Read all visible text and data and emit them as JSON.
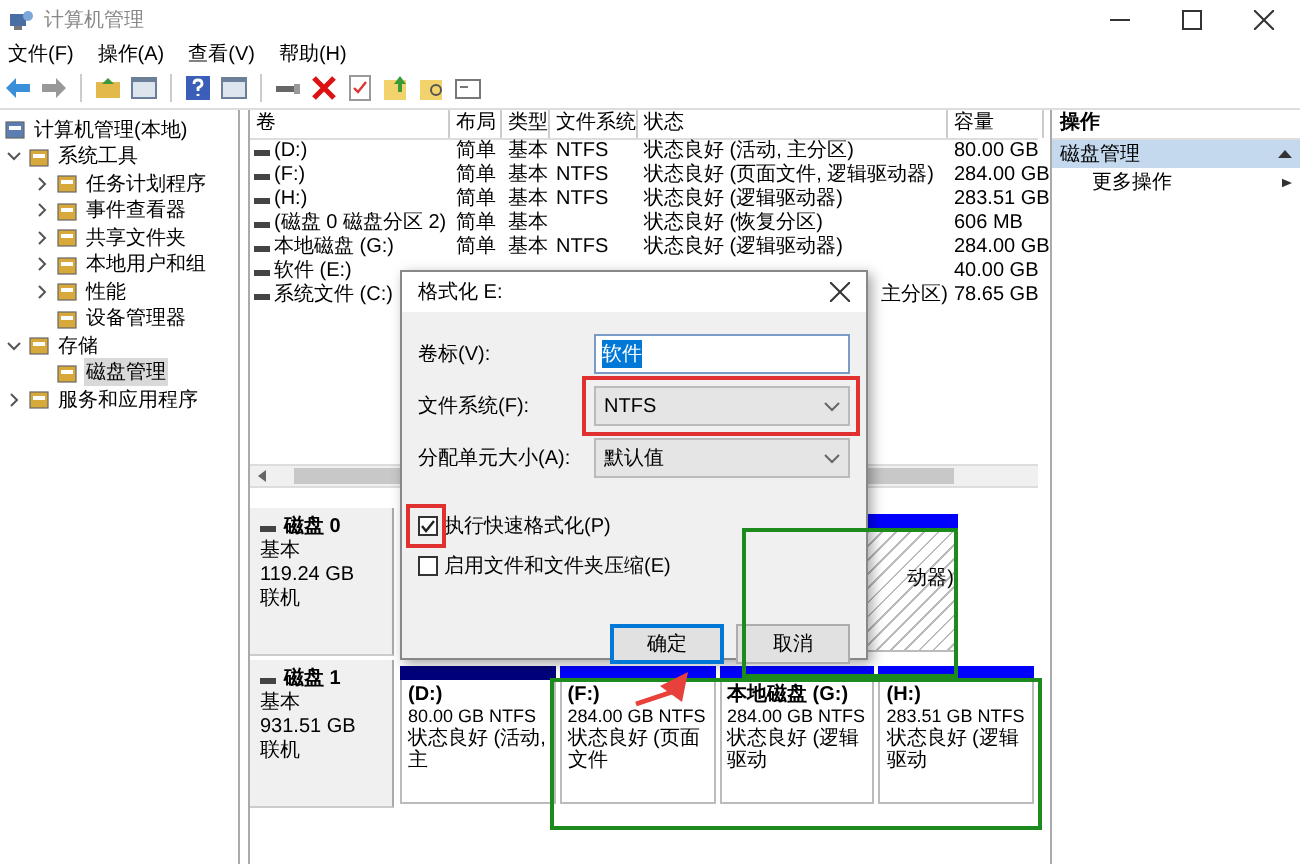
{
  "window": {
    "title": "计算机管理"
  },
  "menu": [
    "文件(F)",
    "操作(A)",
    "查看(V)",
    "帮助(H)"
  ],
  "tree": [
    {
      "label": "计算机管理(本地)",
      "kind": "root",
      "selected": false,
      "children": [
        {
          "label": "系统工具",
          "kind": "group",
          "expanded": true,
          "selected": false,
          "children": [
            {
              "label": "任务计划程序",
              "kind": "group",
              "expanded": false,
              "selected": false
            },
            {
              "label": "事件查看器",
              "kind": "group",
              "expanded": false,
              "selected": false
            },
            {
              "label": "共享文件夹",
              "kind": "group",
              "expanded": false,
              "selected": false
            },
            {
              "label": "本地用户和组",
              "kind": "group",
              "expanded": false,
              "selected": false
            },
            {
              "label": "性能",
              "kind": "group",
              "expanded": false,
              "selected": false
            },
            {
              "label": "设备管理器",
              "kind": "leaf",
              "selected": false
            }
          ]
        },
        {
          "label": "存储",
          "kind": "group",
          "expanded": true,
          "selected": false,
          "children": [
            {
              "label": "磁盘管理",
              "kind": "leaf",
              "selected": true
            }
          ]
        },
        {
          "label": "服务和应用程序",
          "kind": "group",
          "expanded": false,
          "selected": false
        }
      ]
    }
  ],
  "table": {
    "columns": [
      "卷",
      "布局",
      "类型",
      "文件系统",
      "状态",
      "容量"
    ],
    "rows": [
      {
        "volume": "(D:)",
        "layout": "简单",
        "type": "基本",
        "fs": "NTFS",
        "status": "状态良好 (活动, 主分区)",
        "capacity": "80.00 GB"
      },
      {
        "volume": "(F:)",
        "layout": "简单",
        "type": "基本",
        "fs": "NTFS",
        "status": "状态良好 (页面文件, 逻辑驱动器)",
        "capacity": "284.00 GB"
      },
      {
        "volume": "(H:)",
        "layout": "简单",
        "type": "基本",
        "fs": "NTFS",
        "status": "状态良好 (逻辑驱动器)",
        "capacity": "283.51 GB"
      },
      {
        "volume": "(磁盘 0 磁盘分区 2)",
        "layout": "简单",
        "type": "基本",
        "status": "状态良好 (恢复分区)",
        "capacity": "606 MB"
      },
      {
        "volume": "本地磁盘 (G:)",
        "layout": "简单",
        "type": "基本",
        "fs": "NTFS",
        "status": "状态良好 (逻辑驱动器)",
        "capacity": "284.00 GB"
      },
      {
        "volume": "软件 (E:)",
        "capacity": "40.00 GB"
      },
      {
        "volume": "系统文件 (C:)",
        "status": "主分区)",
        "capacity": "78.65 GB"
      }
    ]
  },
  "disks": [
    {
      "name": "磁盘 0",
      "type": "基本",
      "size": "119.24 GB",
      "status": "联机",
      "partitions": [
        {
          "kind": "logical",
          "hatched": true,
          "obscured": true,
          "status": "动器)"
        }
      ]
    },
    {
      "name": "磁盘 1",
      "type": "基本",
      "size": "931.51 GB",
      "status": "联机",
      "partitions": [
        {
          "kind": "primary",
          "hatched": false,
          "obscured": false,
          "title": "(D:)",
          "size": "80.00 GB NTFS",
          "status": "状态良好 (活动, 主"
        },
        {
          "kind": "logical",
          "hatched": false,
          "obscured": false,
          "title": "(F:)",
          "size": "284.00 GB NTFS",
          "status": "状态良好 (页面文件"
        },
        {
          "kind": "logical",
          "hatched": false,
          "obscured": false,
          "title": "本地磁盘  (G:)",
          "size": "284.00 GB NTFS",
          "status": "状态良好 (逻辑驱动"
        },
        {
          "kind": "logical",
          "hatched": false,
          "obscured": false,
          "title": "(H:)",
          "size": "283.51 GB NTFS",
          "status": "状态良好 (逻辑驱动"
        }
      ]
    }
  ],
  "actions": {
    "title": "操作",
    "section": {
      "label": "磁盘管理",
      "expanded": true
    },
    "items": [
      "更多操作"
    ]
  },
  "dialog": {
    "title": "格式化 E:",
    "fields": [
      {
        "kind": "text",
        "label": "卷标(V):",
        "value": "软件",
        "value_selected": true
      },
      {
        "kind": "select",
        "label": "文件系统(F):",
        "value": "NTFS"
      },
      {
        "kind": "select",
        "label": "分配单元大小(A):",
        "value": "默认值"
      }
    ],
    "options": [
      {
        "label": "执行快速格式化(P)",
        "checked": true
      },
      {
        "label": "启用文件和文件夹压缩(E)",
        "checked": false
      }
    ],
    "buttons": [
      {
        "label": "确定",
        "default": true
      },
      {
        "label": "取消",
        "default": false
      }
    ]
  }
}
